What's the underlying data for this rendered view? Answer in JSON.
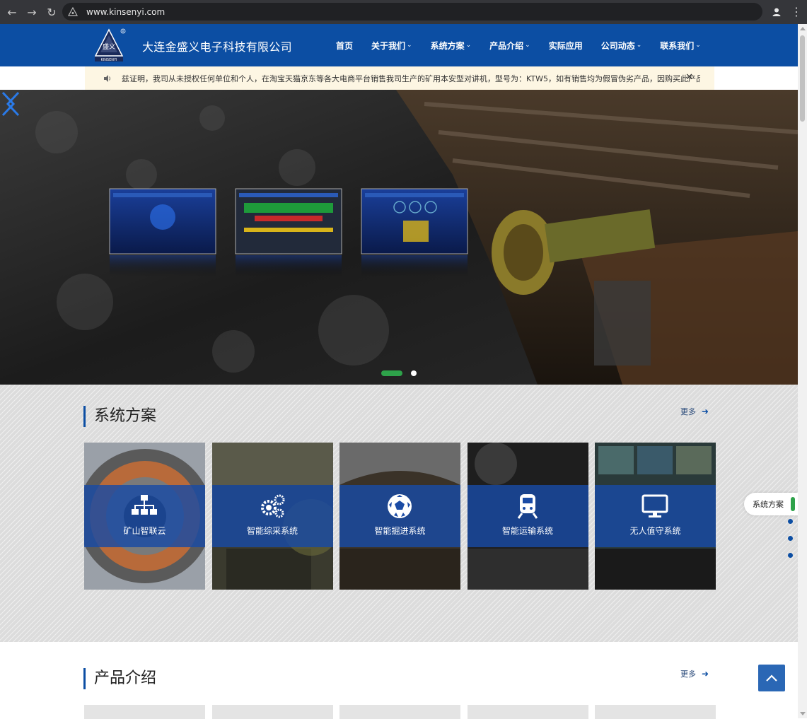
{
  "browser": {
    "url": "www.kinsenyi.com"
  },
  "header": {
    "company_name": "大连金盛义电子科技有限公司",
    "nav": [
      {
        "label": "首页",
        "has_dropdown": false
      },
      {
        "label": "关于我们",
        "has_dropdown": true
      },
      {
        "label": "系统方案",
        "has_dropdown": true
      },
      {
        "label": "产品介绍",
        "has_dropdown": true
      },
      {
        "label": "实际应用",
        "has_dropdown": false
      },
      {
        "label": "公司动态",
        "has_dropdown": true
      },
      {
        "label": "联系我们",
        "has_dropdown": true
      }
    ]
  },
  "notice": {
    "text": "兹证明，我司从未授权任何单位和个人，在淘宝天猫京东等各大电商平台销售我司生产的矿用本安型对讲机，型号为：KTW5，如有销售均为假冒伪劣产品，因购买此产品引"
  },
  "hero": {
    "slide_count": 2,
    "active_slide": 1
  },
  "solutions": {
    "title": "系统方案",
    "more": "更多",
    "cards": [
      {
        "label": "矿山智联云",
        "icon": "sitemap-icon"
      },
      {
        "label": "智能综采系统",
        "icon": "gears-icon"
      },
      {
        "label": "智能掘进系统",
        "icon": "football-icon"
      },
      {
        "label": "智能运输系统",
        "icon": "train-icon"
      },
      {
        "label": "无人值守系统",
        "icon": "monitor-icon"
      }
    ]
  },
  "side_nav": {
    "label": "系统方案"
  },
  "products": {
    "title": "产品介绍",
    "more": "更多"
  },
  "colors": {
    "brand_blue": "#0c4ea3",
    "accent_green": "#2ea24a",
    "notice_bg": "#fdf6e3"
  }
}
